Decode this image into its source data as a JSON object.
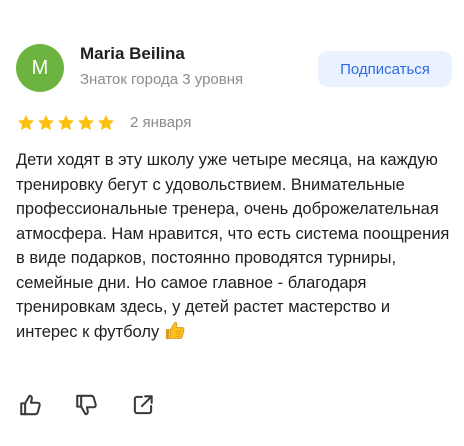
{
  "author": {
    "initial": "M",
    "name": "Maria Beilina",
    "level": "Знаток города 3 уровня",
    "avatar_color": "#6cb33f"
  },
  "subscribe": {
    "label": "Подписаться",
    "accent": "#2f6be8"
  },
  "review": {
    "rating": 5,
    "max_rating": 5,
    "star_color": "#fcc10f",
    "date": "2 января",
    "text": "Дети ходят в эту школу уже четыре месяца, на каждую тренировку бегут с удовольствием. Внимательные профессиональные тренера, очень доброжелательная атмосфера. Нам нравится, что есть система поощрения в виде подарков, постоянно проводятся турниры, семейные дни. Но самое главное - благодаря тренировкам здесь, у детей растет мастерство и интерес к футболу",
    "emoji": "thumbs-up-emoji"
  },
  "actions": [
    {
      "icon": "thumbs-up-icon"
    },
    {
      "icon": "thumbs-down-icon"
    },
    {
      "icon": "share-icon"
    }
  ]
}
